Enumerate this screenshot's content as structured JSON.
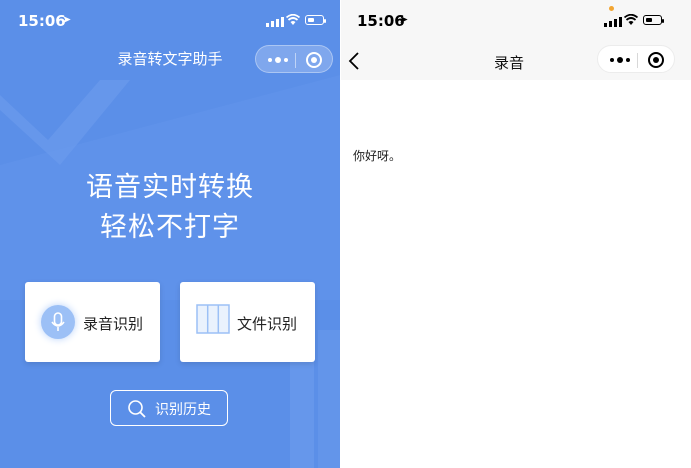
{
  "left_screen": {
    "status_bar": {
      "time": "15:06"
    },
    "nav": {
      "title": "录音转文字助手"
    },
    "hero": {
      "line1": "语音实时转换",
      "line2": "轻松不打字"
    },
    "cards": [
      {
        "label": "录音识别",
        "icon": "microphone-icon"
      },
      {
        "label": "文件识别",
        "icon": "file-columns-icon"
      }
    ],
    "history": {
      "label": "识别历史",
      "icon": "search-icon"
    }
  },
  "right_screen": {
    "status_bar": {
      "time": "15:06"
    },
    "nav": {
      "title": "录音",
      "back_icon": "chevron-left-icon"
    },
    "content": {
      "text": "你好呀。"
    }
  },
  "colors": {
    "accent_blue": "#5b8fe8",
    "orange_dot": "#f2a532"
  }
}
